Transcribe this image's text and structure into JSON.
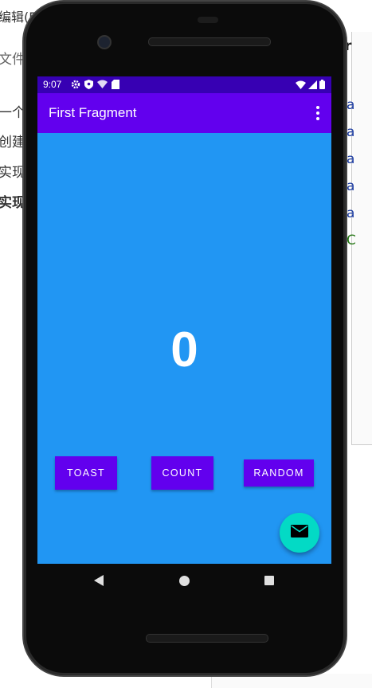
{
  "background": {
    "left_fragments": [
      "编辑(E",
      "文件",
      "一个",
      "创建",
      "实现",
      "实现"
    ],
    "right_fragments": [
      "r",
      "a",
      "a",
      "a",
      "a",
      "a",
      "C"
    ]
  },
  "status_bar": {
    "time": "9:07",
    "left_icons": [
      "gear-icon",
      "shield-icon",
      "wifi-question-icon",
      "sd-card-icon"
    ],
    "right_icons": [
      "wifi-icon",
      "cell-signal-icon",
      "battery-icon"
    ]
  },
  "app_bar": {
    "title": "First Fragment",
    "menu_icon": "overflow-menu-icon"
  },
  "main": {
    "count_value": "0",
    "buttons": {
      "toast": "TOAST",
      "count": "COUNT",
      "random": "RANDOM"
    },
    "fab_icon": "email-icon"
  },
  "nav_bar": {
    "icons": [
      "back-icon",
      "home-icon",
      "recents-icon"
    ]
  },
  "colors": {
    "primary": "#6200ee",
    "primary_dark": "#3700b3",
    "accent": "#03dac5",
    "content_background": "#2196f3"
  }
}
